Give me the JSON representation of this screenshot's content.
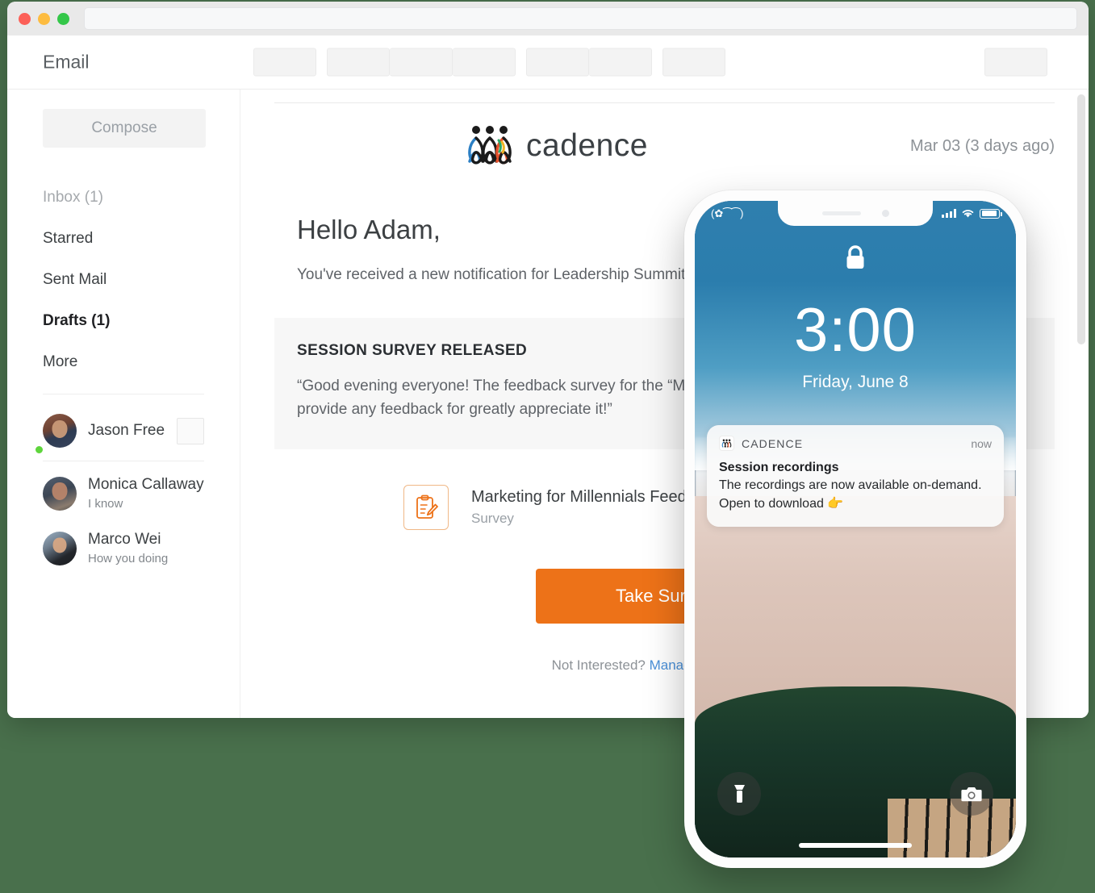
{
  "window": {
    "app_title": "Email",
    "url_placeholder": ""
  },
  "sidebar": {
    "compose_label": "Compose",
    "nav": [
      {
        "label": "Inbox (1)",
        "style": "muted"
      },
      {
        "label": "Starred",
        "style": "normal"
      },
      {
        "label": "Sent Mail",
        "style": "normal"
      },
      {
        "label": "Drafts (1)",
        "style": "bold"
      },
      {
        "label": "More",
        "style": "normal"
      }
    ],
    "contacts": [
      {
        "name": "Jason Free",
        "message": "",
        "online": true
      },
      {
        "name": "Monica Callaway",
        "message": "I know",
        "online": false
      },
      {
        "name": "Marco Wei",
        "message": "How you doing",
        "online": false
      }
    ]
  },
  "email": {
    "brand": "cadence",
    "date": "Mar 03 (3 days ago)",
    "greeting": "Hello Adam,",
    "intro": "You've received a new notification for Leadership Summit 201",
    "card_title": "SESSION SURVEY RELEASED",
    "card_body": "“Good evening everyone! The feedback survey for the “Marketing been released. Please take a moment to provide any feedback for greatly appreciate it!”",
    "attachment_name": "Marketing for Millennials Feedback S",
    "attachment_type": "Survey",
    "cta_label": "Take Survey",
    "footer_text": "Not Interested?",
    "footer_link": "Manage Notifications"
  },
  "phone": {
    "status": {
      "carrier": "(✿⁀⁀)",
      "signal": "signal-bars",
      "wifi": "wifi-icon",
      "battery": "battery-icon"
    },
    "lock": {
      "time": "3:00",
      "date": "Friday, June 8"
    },
    "notification": {
      "app": "CADENCE",
      "time": "now",
      "title": "Session recordings",
      "body": "The recordings are now available on-demand. Open to download 👉"
    },
    "quick_actions": {
      "left": "flashlight",
      "right": "camera"
    }
  },
  "colors": {
    "page_background": "#49704C",
    "cta_orange": "#ED7218",
    "link_blue": "#4a90d9",
    "online_green": "#5ed53c"
  }
}
